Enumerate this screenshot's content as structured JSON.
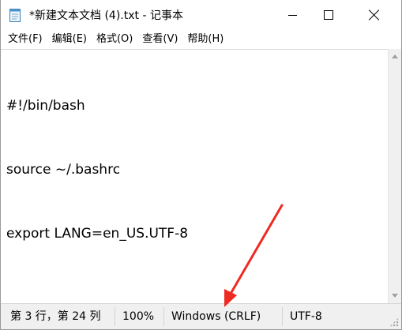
{
  "window": {
    "title": "*新建文本文档 (4).txt - 记事本"
  },
  "menu": {
    "items": [
      "文件(F)",
      "编辑(E)",
      "格式(O)",
      "查看(V)",
      "帮助(H)"
    ]
  },
  "editor": {
    "lines": [
      "#!/bin/bash",
      "source ~/.bashrc",
      "export LANG=en_US.UTF-8"
    ]
  },
  "status": {
    "position": "第 3 行，第 24 列",
    "zoom": "100%",
    "line_ending": "Windows (CRLF)",
    "encoding": "UTF-8"
  },
  "colors": {
    "annotation_arrow": "#ee2b22"
  },
  "icons": {
    "app": "notepad-icon",
    "minimize": "minimize-icon",
    "maximize": "maximize-icon",
    "close": "close-icon"
  }
}
